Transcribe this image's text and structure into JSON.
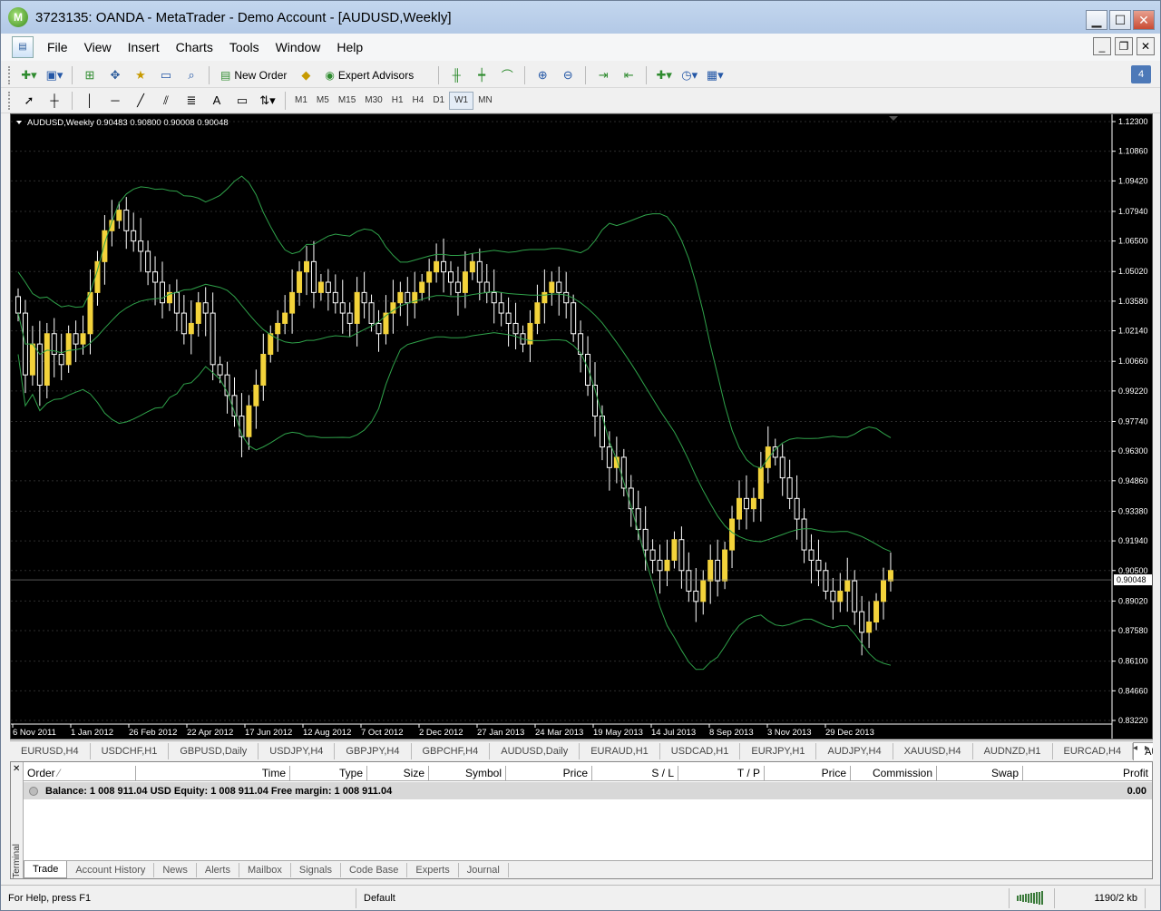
{
  "window": {
    "title": "3723135: OANDA - MetaTrader - Demo Account - [AUDUSD,Weekly]",
    "buttons": {
      "minimize": "▁",
      "maximize": "☐",
      "close": "✕"
    }
  },
  "menu": {
    "items": [
      "File",
      "View",
      "Insert",
      "Charts",
      "Tools",
      "Window",
      "Help"
    ],
    "mdi_buttons": {
      "minimize": "_",
      "restore": "❐",
      "close": "✕"
    }
  },
  "toolbar1": {
    "new_order_label": "New Order",
    "expert_advisors_label": "Expert Advisors",
    "messages_badge": "4"
  },
  "toolbar2": {
    "timeframes": [
      "M1",
      "M5",
      "M15",
      "M30",
      "H1",
      "H4",
      "D1",
      "W1",
      "MN"
    ],
    "active_timeframe": "W1",
    "text_tool": "A"
  },
  "chart": {
    "header": "AUDUSD,Weekly  0.90483 0.90800 0.90008 0.90048",
    "current_price_label": "0.90048",
    "colors": {
      "background": "#000000",
      "grid": "#2c2c2c",
      "bull": "#f3d33b",
      "bear": "#ffffff",
      "bands": "#2fa24a",
      "axis_text": "#ffffff"
    }
  },
  "chart_data": {
    "type": "candlestick",
    "symbol": "AUDUSD",
    "timeframe": "Weekly",
    "y_ticks": [
      "1.12300",
      "1.10860",
      "1.09420",
      "1.07940",
      "1.06500",
      "1.05020",
      "1.03580",
      "1.02140",
      "1.00660",
      "0.99220",
      "0.97740",
      "0.96300",
      "0.94860",
      "0.93380",
      "0.91940",
      "0.90500",
      "0.89020",
      "0.87580",
      "0.86100",
      "0.84660",
      "0.83220"
    ],
    "x_ticks": [
      "6 Nov 2011",
      "1 Jan 2012",
      "26 Feb 2012",
      "22 Apr 2012",
      "17 Jun 2012",
      "12 Aug 2012",
      "7 Oct 2012",
      "2 Dec 2012",
      "27 Jan 2013",
      "24 Mar 2013",
      "19 May 2013",
      "14 Jul 2013",
      "8 Sep 2013",
      "3 Nov 2013",
      "29 Dec 2013"
    ],
    "ylim": [
      0.8322,
      1.123
    ],
    "close": [
      1.03,
      1.0,
      1.015,
      0.995,
      1.02,
      1.01,
      1.005,
      1.02,
      1.015,
      1.02,
      1.04,
      1.055,
      1.07,
      1.075,
      1.08,
      1.07,
      1.065,
      1.06,
      1.05,
      1.045,
      1.035,
      1.04,
      1.03,
      1.02,
      1.025,
      1.035,
      1.03,
      1.005,
      1.0,
      0.99,
      0.98,
      0.97,
      0.985,
      0.995,
      1.01,
      1.02,
      1.025,
      1.03,
      1.04,
      1.05,
      1.055,
      1.04,
      1.045,
      1.04,
      1.035,
      1.03,
      1.025,
      1.04,
      1.035,
      1.025,
      1.02,
      1.03,
      1.035,
      1.04,
      1.035,
      1.04,
      1.045,
      1.05,
      1.055,
      1.05,
      1.045,
      1.04,
      1.05,
      1.055,
      1.045,
      1.04,
      1.035,
      1.03,
      1.025,
      1.02,
      1.015,
      1.025,
      1.035,
      1.04,
      1.045,
      1.04,
      1.035,
      1.02,
      1.01,
      0.995,
      0.98,
      0.965,
      0.955,
      0.96,
      0.945,
      0.935,
      0.925,
      0.915,
      0.91,
      0.905,
      0.91,
      0.92,
      0.905,
      0.895,
      0.89,
      0.9,
      0.91,
      0.9,
      0.915,
      0.93,
      0.94,
      0.935,
      0.94,
      0.955,
      0.965,
      0.96,
      0.95,
      0.94,
      0.93,
      0.915,
      0.91,
      0.905,
      0.895,
      0.89,
      0.895,
      0.9,
      0.885,
      0.875,
      0.88,
      0.89,
      0.9,
      0.905
    ],
    "current_price": 0.90048
  },
  "chart_tabs": [
    "EURUSD,H4",
    "USDCHF,H1",
    "GBPUSD,Daily",
    "USDJPY,H4",
    "GBPJPY,H4",
    "GBPCHF,H4",
    "AUDUSD,Daily",
    "EURAUD,H1",
    "USDCAD,H1",
    "EURJPY,H1",
    "AUDJPY,H4",
    "XAUUSD,H4",
    "AUDNZD,H1",
    "EURCAD,H4",
    "AUDUSD,Weekly"
  ],
  "chart_tabs_active": "AUDUSD,Weekly",
  "terminal": {
    "side_label": "Terminal",
    "close_label": "✕",
    "columns": [
      "Order",
      "Time",
      "Type",
      "Size",
      "Symbol",
      "Price",
      "S / L",
      "T / P",
      "Price",
      "Commission",
      "Swap",
      "Profit"
    ],
    "balance_text": "Balance: 1 008 911.04 USD  Equity: 1 008 911.04  Free margin: 1 008 911.04",
    "profit": "0.00",
    "tabs": [
      "Trade",
      "Account History",
      "News",
      "Alerts",
      "Mailbox",
      "Signals",
      "Code Base",
      "Experts",
      "Journal"
    ],
    "active_tab": "Trade"
  },
  "status": {
    "help": "For Help, press F1",
    "profile": "Default",
    "traffic": "1190/2 kb"
  }
}
